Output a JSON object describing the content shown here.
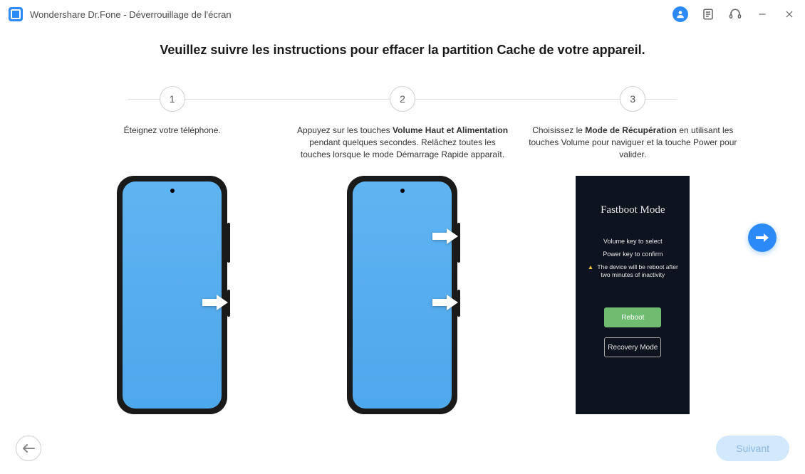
{
  "header": {
    "app_title": "Wondershare Dr.Fone - Déverrouillage de l'écran"
  },
  "main": {
    "title": "Veuillez suivre les instructions pour effacer la partition Cache de votre appareil."
  },
  "steps": [
    {
      "num": "1",
      "text_before": "Éteignez votre téléphone.",
      "bold": "",
      "text_after": ""
    },
    {
      "num": "2",
      "text_before": "Appuyez sur les touches ",
      "bold": "Volume Haut et Alimentation",
      "text_after": " pendant quelques secondes. Relâchez toutes les touches lorsque le mode Démarrage Rapide apparaît."
    },
    {
      "num": "3",
      "text_before": "Choisissez le ",
      "bold": "Mode de Récupération",
      "text_after": " en utilisant les touches Volume pour naviguer et la touche Power pour valider."
    }
  ],
  "fastboot": {
    "title": "Fastboot Mode",
    "line1": "Volume key to select",
    "line2": "Power key to confirm",
    "warning": "The device will be reboot after two minutes of inactivity",
    "btn_reboot": "Reboot",
    "btn_recovery": "Recovery Mode"
  },
  "footer": {
    "next_label": "Suivant"
  },
  "colors": {
    "accent": "#2b8af7",
    "phone_screen": "#5fb4f1",
    "fastboot_bg": "#0e1320",
    "reboot_green": "#6fbb6f"
  }
}
